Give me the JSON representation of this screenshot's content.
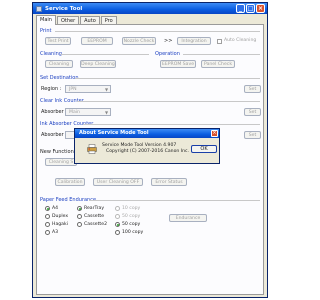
{
  "window": {
    "title": "Service Tool",
    "tabs": [
      "Main",
      "Other",
      "Auto",
      "Pro"
    ]
  },
  "print": {
    "header": "Print",
    "buttons": [
      "Test Print",
      "EEPROM",
      "Nozzle Check",
      ">>",
      "Integration"
    ],
    "auto_cleaning": "Auto Cleaning"
  },
  "cleaning": {
    "header": "Cleaning",
    "buttons": [
      "Cleaning",
      "Deep Cleaning"
    ]
  },
  "operation": {
    "header": "Operation",
    "buttons": [
      "EEPROM Save",
      "Panel Check"
    ]
  },
  "set_destination": {
    "header": "Set Destination",
    "label": "Region :",
    "value": "JPN",
    "set": "Set"
  },
  "clear_ink": {
    "header": "Clear Ink Counter",
    "label": "Absorber",
    "value": "Main",
    "set": "Set"
  },
  "ink_absorber": {
    "header": "Ink Absorber Counter",
    "label": "Absorber",
    "set": "Set"
  },
  "new_function": {
    "header": "New Function",
    "buttons": [
      "Cleaning S",
      "Calibration",
      "User Cleaning OFF",
      "Error Status"
    ]
  },
  "paper_feed": {
    "header": "Paper Feed Endurance",
    "col1": [
      "A4",
      "Duplex",
      "Hagaki",
      "A3"
    ],
    "col2": [
      "RearTray",
      "Cassette",
      "Cassette2"
    ],
    "col3": [
      "10 copy",
      "50 copy",
      "50 copy",
      "100 copy"
    ],
    "button": "Endurance"
  },
  "dialog": {
    "title": "About Service Mode Tool",
    "line1": "Service Mode Tool  Version 4.907",
    "line2": "Copyright (C) 2007-2016 Canon Inc.",
    "ok": "OK"
  },
  "colors": {
    "accent": "#0a5ce0",
    "header_text": "#1a3ec0",
    "close": "#d8532f"
  }
}
